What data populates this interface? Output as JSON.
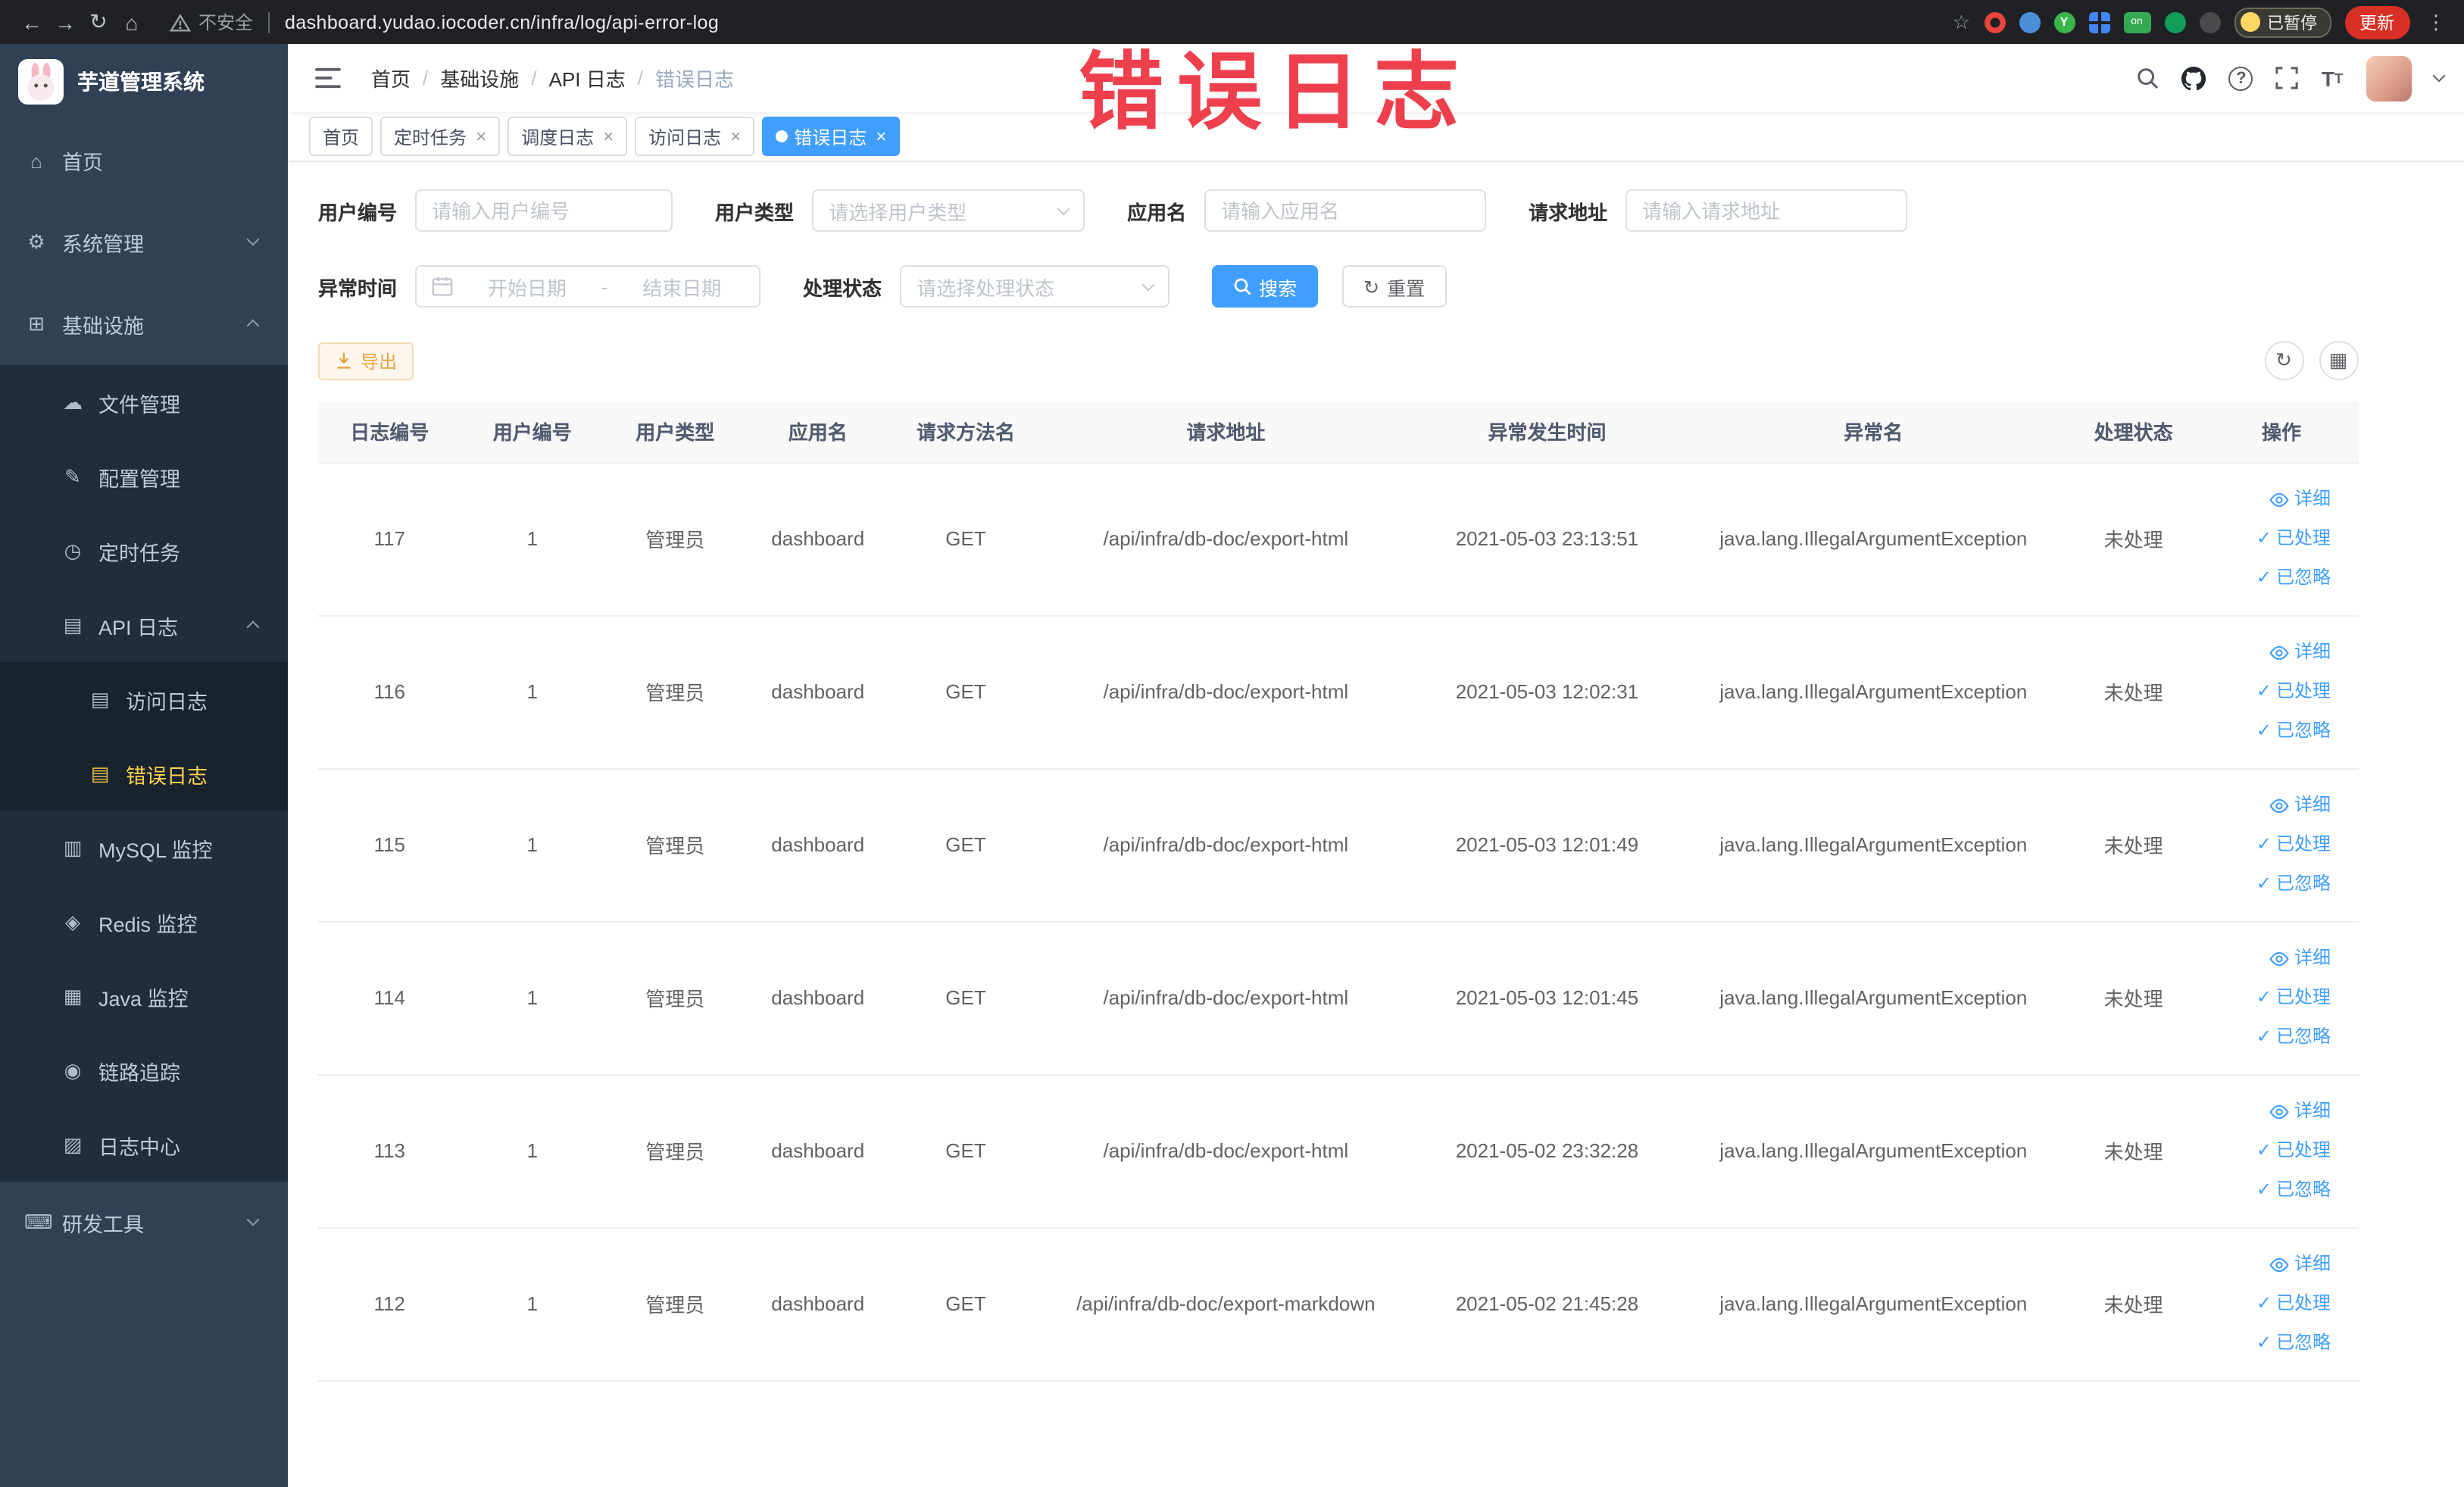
{
  "colors": {
    "accent": "#409eff",
    "sidebar_bg": "#304156",
    "active_menu_text": "#ffd04b",
    "warning": "#e6a23c",
    "annotation_red": "#ee3f4d"
  },
  "browser": {
    "security_label": "不安全",
    "url": "dashboard.yudao.iocoder.cn/infra/log/api-error-log",
    "paused_badge": "已暂停",
    "update_label": "更新",
    "extension_on_badge": "on",
    "extension_y_label": "Y"
  },
  "annotation": "错误日志",
  "sidebar": {
    "title": "芋道管理系统",
    "items": {
      "home": "首页",
      "system": "系统管理",
      "infra": "基础设施",
      "file": "文件管理",
      "config": "配置管理",
      "job": "定时任务",
      "api_log": "API 日志",
      "access_log": "访问日志",
      "error_log": "错误日志",
      "mysql": "MySQL 监控",
      "redis": "Redis 监控",
      "java": "Java 监控",
      "trace": "链路追踪",
      "log_center": "日志中心",
      "dev_tools": "研发工具"
    }
  },
  "header": {
    "breadcrumb": [
      "首页",
      "基础设施",
      "API 日志",
      "错误日志"
    ],
    "breadcrumb_separator": "/"
  },
  "tabs": {
    "items": [
      {
        "label": "首页",
        "closable": false,
        "active": false
      },
      {
        "label": "定时任务",
        "closable": true,
        "active": false
      },
      {
        "label": "调度日志",
        "closable": true,
        "active": false
      },
      {
        "label": "访问日志",
        "closable": true,
        "active": false
      },
      {
        "label": "错误日志",
        "closable": true,
        "active": true
      }
    ]
  },
  "filters": {
    "user_id": {
      "label": "用户编号",
      "placeholder": "请输入用户编号"
    },
    "user_type": {
      "label": "用户类型",
      "placeholder": "请选择用户类型"
    },
    "app_name": {
      "label": "应用名",
      "placeholder": "请输入应用名"
    },
    "request_url": {
      "label": "请求地址",
      "placeholder": "请输入请求地址"
    },
    "exception_time": {
      "label": "异常时间",
      "start_placeholder": "开始日期",
      "separator": "-",
      "end_placeholder": "结束日期"
    },
    "process_status": {
      "label": "处理状态",
      "placeholder": "请选择处理状态"
    },
    "search_label": "搜索",
    "reset_label": "重置"
  },
  "toolbar": {
    "export_label": "导出"
  },
  "table": {
    "columns": [
      "日志编号",
      "用户编号",
      "用户类型",
      "应用名",
      "请求方法名",
      "请求地址",
      "异常发生时间",
      "异常名",
      "处理状态",
      "操作"
    ],
    "row_actions": {
      "detail": "详细",
      "processed": "已处理",
      "ignored": "已忽略"
    },
    "rows": [
      {
        "log_id": 117,
        "user_id": 1,
        "user_type": "管理员",
        "app_name": "dashboard",
        "method": "GET",
        "url": "/api/infra/db-doc/export-html",
        "time": "2021-05-03 23:13:51",
        "exception": "java.lang.IllegalArgumentException",
        "status": "未处理"
      },
      {
        "log_id": 116,
        "user_id": 1,
        "user_type": "管理员",
        "app_name": "dashboard",
        "method": "GET",
        "url": "/api/infra/db-doc/export-html",
        "time": "2021-05-03 12:02:31",
        "exception": "java.lang.IllegalArgumentException",
        "status": "未处理"
      },
      {
        "log_id": 115,
        "user_id": 1,
        "user_type": "管理员",
        "app_name": "dashboard",
        "method": "GET",
        "url": "/api/infra/db-doc/export-html",
        "time": "2021-05-03 12:01:49",
        "exception": "java.lang.IllegalArgumentException",
        "status": "未处理"
      },
      {
        "log_id": 114,
        "user_id": 1,
        "user_type": "管理员",
        "app_name": "dashboard",
        "method": "GET",
        "url": "/api/infra/db-doc/export-html",
        "time": "2021-05-03 12:01:45",
        "exception": "java.lang.IllegalArgumentException",
        "status": "未处理"
      },
      {
        "log_id": 113,
        "user_id": 1,
        "user_type": "管理员",
        "app_name": "dashboard",
        "method": "GET",
        "url": "/api/infra/db-doc/export-html",
        "time": "2021-05-02 23:32:28",
        "exception": "java.lang.IllegalArgumentException",
        "status": "未处理"
      },
      {
        "log_id": 112,
        "user_id": 1,
        "user_type": "管理员",
        "app_name": "dashboard",
        "method": "GET",
        "url": "/api/infra/db-doc/export-markdown",
        "time": "2021-05-02 21:45:28",
        "exception": "java.lang.IllegalArgumentException",
        "status": "未处理"
      }
    ]
  }
}
